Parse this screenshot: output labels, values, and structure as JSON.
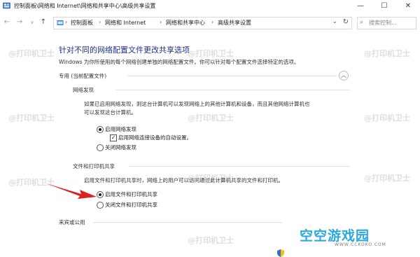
{
  "window": {
    "title": "控制面板\\网络和 Internet\\网络和共享中心\\高级共享设置",
    "minimize": "—",
    "maximize": "☐",
    "close": "✕"
  },
  "nav": {
    "back": "←",
    "forward": "→",
    "recent": "∨",
    "up": "↑",
    "breadcrumbs": [
      "控制面板",
      "网络和 Internet",
      "网络和共享中心",
      "高级共享设置"
    ],
    "separator": "›",
    "search_placeholder": "搜索控制..."
  },
  "main": {
    "heading": "针对不同的网络配置文件更改共享选项",
    "description": "Windows 为你所使用的每个网络创建单独的网络配置文件。你可以针对每个配置文件选择特定的选项。",
    "private_section": {
      "label": "专用 (当前配置文件)",
      "network_discovery": {
        "label": "网络发现",
        "desc_line1": "如果已启用网络发现，则这台计算机可以发现网络上的其他计算机和设备，而且其他网络计算机也",
        "desc_line2": "可以发现这台计算机。",
        "options": {
          "on": "启用网络发现",
          "auto_setup": "启用网络连接设备的自动设置。",
          "off": "关闭网络发现"
        }
      },
      "file_printer_sharing": {
        "label": "文件和打印机共享",
        "desc": "启用文件和打印机共享时，网络上的用户可以访问通过此计算机共享的文件和打印机。",
        "options": {
          "on": "启用文件和打印机共享",
          "off": "关闭文件和打印机共享"
        }
      }
    },
    "guest_section": {
      "label": "来宾或公用"
    }
  },
  "watermarks": [
    "@打印机卫士",
    "@打印机卫士",
    "@打印机卫士",
    "@打印机卫士",
    "@打印机卫士",
    "@打印机卫士",
    "@打印机卫士",
    "@打印机卫士",
    "@打印机卫士",
    "@打印机卫士"
  ],
  "branding": {
    "name": "空空游戏园",
    "url": "WWW.CCKOKO.COM"
  },
  "icons": {
    "title_icon": "control-panel-icon",
    "address_icon": "folder-icon",
    "search_icon": "search-icon",
    "refresh_icon": "refresh-icon",
    "chevron": "chevron-up-icon",
    "annotation": "red-arrow"
  },
  "colors": {
    "heading": "#1e3287",
    "annotation_arrow": "#e02020",
    "brand": "#2aa9e0"
  }
}
